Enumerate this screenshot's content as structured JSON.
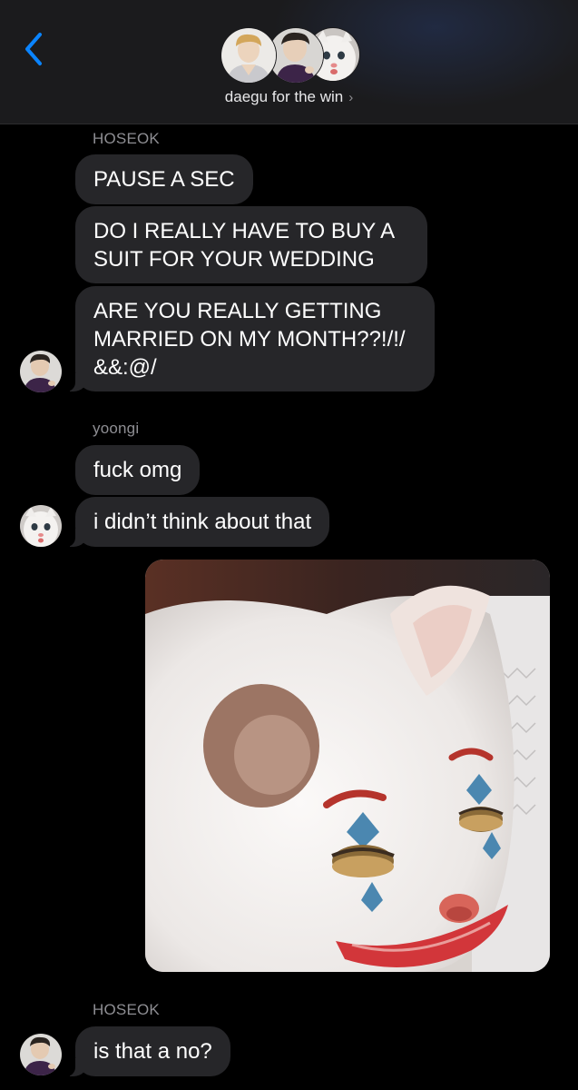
{
  "header": {
    "group_name": "daegu for the win",
    "chevron": "›",
    "back_icon": "chevron-left-icon",
    "accent": "#0a84ff"
  },
  "messages": [
    {
      "sender": "HOSEOK",
      "bubbles": [
        "PAUSE A SEC",
        "DO I REALLY HAVE TO BUY A SUIT FOR YOUR WEDDING",
        "ARE YOU REALLY GETTING MARRIED ON MY MONTH??!/!/ &&:@/"
      ]
    },
    {
      "sender": "yoongi",
      "bubbles": [
        "fuck omg",
        "i didn’t think about that"
      ],
      "image": "clown-cat-meme"
    },
    {
      "sender": "HOSEOK",
      "bubbles": [
        "is that a no?"
      ]
    }
  ],
  "colors": {
    "background": "#000000",
    "bubble": "#262629",
    "sender_text": "#8e8e93"
  }
}
